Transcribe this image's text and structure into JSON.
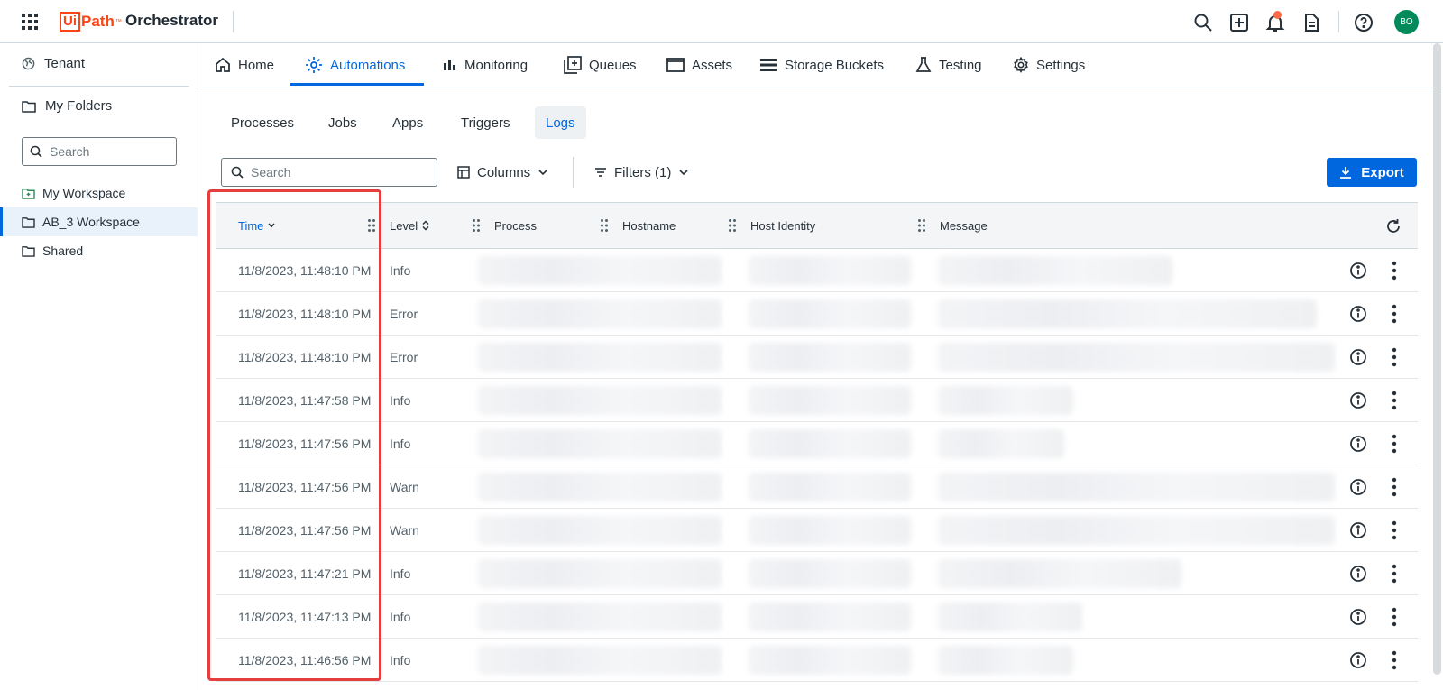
{
  "header": {
    "logo_box": "Ui",
    "logo_path": "Path",
    "logo_tm": "™",
    "product": "Orchestrator",
    "avatar_initials": "BO",
    "accent": "#fa4616"
  },
  "sidebar": {
    "tenant": "Tenant",
    "my_folders": "My Folders",
    "search_placeholder": "Search",
    "folders": [
      {
        "label": "My Workspace",
        "icon": "workspace-folder-icon"
      },
      {
        "label": "AB_3 Workspace",
        "icon": "folder-icon",
        "active": true
      },
      {
        "label": "Shared",
        "icon": "folder-icon"
      }
    ]
  },
  "nav": {
    "items": [
      {
        "label": "Home",
        "icon": "home-icon"
      },
      {
        "label": "Automations",
        "icon": "automations-icon",
        "active": true
      },
      {
        "label": "Monitoring",
        "icon": "monitoring-icon"
      },
      {
        "label": "Queues",
        "icon": "queues-icon"
      },
      {
        "label": "Assets",
        "icon": "assets-icon"
      },
      {
        "label": "Storage Buckets",
        "icon": "storage-icon"
      },
      {
        "label": "Testing",
        "icon": "testing-icon"
      },
      {
        "label": "Settings",
        "icon": "gear-icon"
      }
    ]
  },
  "subtabs": [
    "Processes",
    "Jobs",
    "Apps",
    "Triggers",
    "Logs"
  ],
  "toolbar": {
    "search_placeholder": "Search",
    "columns_label": "Columns",
    "filters_label": "Filters (1)",
    "export_label": "Export"
  },
  "table": {
    "columns": [
      "Time",
      "Level",
      "Process",
      "Hostname",
      "Host Identity",
      "Message"
    ],
    "rows": [
      {
        "time": "11/8/2023, 11:48:10 PM",
        "level": "Info"
      },
      {
        "time": "11/8/2023, 11:48:10 PM",
        "level": "Error"
      },
      {
        "time": "11/8/2023, 11:48:10 PM",
        "level": "Error"
      },
      {
        "time": "11/8/2023, 11:47:58 PM",
        "level": "Info"
      },
      {
        "time": "11/8/2023, 11:47:56 PM",
        "level": "Info"
      },
      {
        "time": "11/8/2023, 11:47:56 PM",
        "level": "Warn"
      },
      {
        "time": "11/8/2023, 11:47:56 PM",
        "level": "Warn"
      },
      {
        "time": "11/8/2023, 11:47:21 PM",
        "level": "Info"
      },
      {
        "time": "11/8/2023, 11:47:13 PM",
        "level": "Info"
      },
      {
        "time": "11/8/2023, 11:46:56 PM",
        "level": "Info"
      }
    ]
  },
  "colors": {
    "primary": "#0067df",
    "highlight": "#e53e3e",
    "avatar": "#038a5a"
  }
}
